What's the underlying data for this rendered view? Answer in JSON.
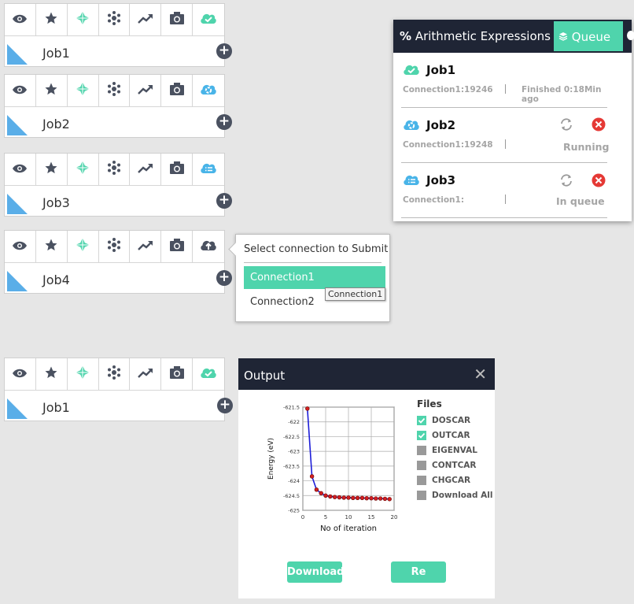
{
  "jobs": [
    {
      "name": "Job1",
      "status_icon": "check-cloud-icon"
    },
    {
      "name": "Job2",
      "status_icon": "running-cloud-icon"
    },
    {
      "name": "Job3",
      "status_icon": "queued-cloud-icon"
    },
    {
      "name": "Job4",
      "status_icon": "upload-cloud-icon"
    },
    {
      "name": "Job1",
      "status_icon": "check-cloud-icon"
    }
  ],
  "toolbar_icons": [
    "eye-icon",
    "star-icon",
    "crystal-icon",
    "molecule-icon",
    "trend-icon",
    "camera-icon"
  ],
  "colors": {
    "accent": "#4fd4ac",
    "dark": "#1f2535",
    "blue": "#49b4e8",
    "triangle": "#5aaee8",
    "red": "#e53935"
  },
  "submit_popover": {
    "title": "Select connection to Submit",
    "options": [
      "Connection1",
      "Connection2"
    ],
    "selected": "Connection1",
    "tooltip": "Connection1"
  },
  "queue_panel": {
    "title": "Arithmetic Expressions",
    "tab": "Queue",
    "items": [
      {
        "name": "Job1",
        "connection": "Connection1:19246",
        "status": "Finished 0:18Min ago"
      },
      {
        "name": "Job2",
        "connection": "Connection1:19248",
        "status": "Running"
      },
      {
        "name": "Job3",
        "connection": "Connection1:",
        "status": "In queue"
      }
    ]
  },
  "output": {
    "title": "Output",
    "files_title": "Files",
    "files": [
      {
        "label": "DOSCAR",
        "checked": true
      },
      {
        "label": "OUTCAR",
        "checked": true
      },
      {
        "label": "EIGENVAL",
        "checked": false
      },
      {
        "label": "CONTCAR",
        "checked": false
      },
      {
        "label": "CHGCAR",
        "checked": false
      },
      {
        "label": "Download All",
        "checked": false
      }
    ],
    "download_label": "Download",
    "resubmit_label": "Re Submit"
  },
  "chart_data": {
    "type": "line",
    "xlabel": "No of iteration",
    "ylabel": "Energy (eV)",
    "xlim": [
      0,
      20
    ],
    "ylim": [
      -625,
      -621.5
    ],
    "xticks": [
      "0",
      "5",
      "10",
      "15",
      "20"
    ],
    "yticks": [
      "-621.5",
      "-622",
      "-622.5",
      "-623",
      "-623.5",
      "-624",
      "-624.5",
      "-625"
    ],
    "grid": true,
    "series": [
      {
        "x": [
          1,
          2,
          3,
          4,
          5,
          6,
          7,
          8,
          9,
          10,
          11,
          12,
          13,
          14,
          15,
          16,
          17,
          18,
          19
        ],
        "y": [
          -621.55,
          -623.85,
          -624.3,
          -624.42,
          -624.5,
          -624.53,
          -624.55,
          -624.56,
          -624.57,
          -624.57,
          -624.58,
          -624.58,
          -624.58,
          -624.59,
          -624.59,
          -624.6,
          -624.6,
          -624.61,
          -624.62
        ]
      }
    ]
  }
}
